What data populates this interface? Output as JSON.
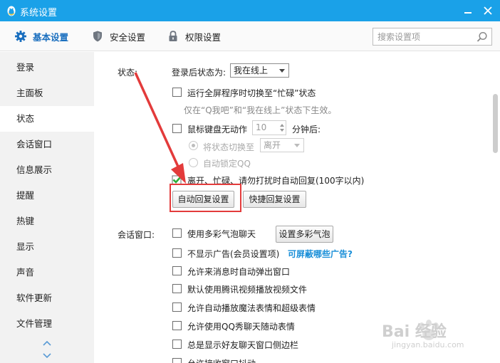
{
  "window": {
    "title": "系统设置"
  },
  "toolbar": {
    "tabs": [
      {
        "label": "基本设置",
        "icon": "gear-icon",
        "active": true
      },
      {
        "label": "安全设置",
        "icon": "shield-icon",
        "active": false
      },
      {
        "label": "权限设置",
        "icon": "lock-icon",
        "active": false
      }
    ],
    "search_placeholder": "搜索设置项"
  },
  "sidebar": {
    "items": [
      {
        "label": "登录"
      },
      {
        "label": "主面板"
      },
      {
        "label": "状态",
        "active": true
      },
      {
        "label": "会话窗口"
      },
      {
        "label": "信息展示"
      },
      {
        "label": "提醒"
      },
      {
        "label": "热键"
      },
      {
        "label": "显示"
      },
      {
        "label": "声音"
      },
      {
        "label": "软件更新"
      },
      {
        "label": "文件管理"
      }
    ]
  },
  "status_section": {
    "heading": "状态:",
    "login_status_label": "登录后状态为:",
    "login_status_value": "我在线上",
    "fullscreen_busy": {
      "label": "运行全屏程序时切换至“忙碌”状态",
      "checked": false
    },
    "fullscreen_note": "仅在“Q我吧”和“我在线上”状态下生效。",
    "idle": {
      "label": "鼠标键盘无动作",
      "minutes": "10",
      "suffix": "分钟后:",
      "checked": false
    },
    "idle_switch": {
      "label": "将状态切换至",
      "value": "离开",
      "selected": true
    },
    "idle_lock": {
      "label": "自动锁定QQ",
      "selected": false
    },
    "auto_reply": {
      "label": "离开、忙碌、请勿打扰时自动回复(100字以内)",
      "checked": true
    },
    "auto_reply_button": "自动回复设置",
    "quick_reply_button": "快捷回复设置"
  },
  "chat_section": {
    "heading": "会话窗口:",
    "options": [
      {
        "label": "使用多彩气泡聊天",
        "checked": false
      },
      {
        "label": "不显示广告(会员设置项)",
        "checked": false
      },
      {
        "label": "允许来消息时自动弹出窗口",
        "checked": false
      },
      {
        "label": "默认使用腾讯视频播放视频文件",
        "checked": false
      },
      {
        "label": "允许自动播放魔法表情和超级表情",
        "checked": false
      },
      {
        "label": "允许使用QQ秀聊天随动表情",
        "checked": false
      },
      {
        "label": "总是显示好友聊天窗口侧边栏",
        "checked": false
      },
      {
        "label": "允许接收窗口抖动",
        "checked": false
      }
    ],
    "bubble_button": "设置多彩气泡",
    "ads_link": "可屏蔽哪些广告?"
  },
  "watermark": {
    "brand": "Bai 经验",
    "url": "jingyan.baidu.com"
  },
  "colors": {
    "titlebar": "#1aa1e8",
    "accent": "#1a6fbf",
    "link": "#1a8fd8",
    "annotation": "#e33b3b",
    "check": "#2fae3a"
  }
}
